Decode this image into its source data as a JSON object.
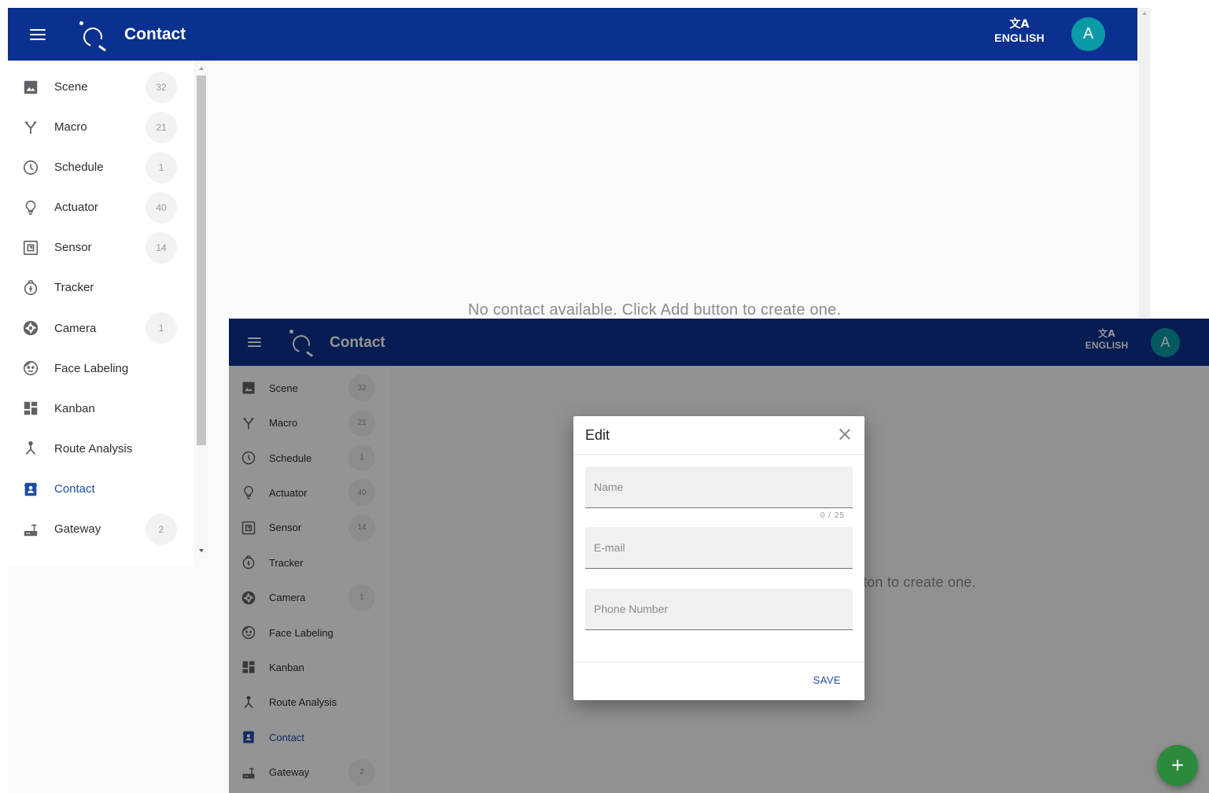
{
  "app": {
    "title": "Contact",
    "language": "ENGLISH",
    "avatar_initial": "A"
  },
  "sidebar": {
    "items": [
      {
        "label": "Scene",
        "icon": "image-icon",
        "count": "32"
      },
      {
        "label": "Macro",
        "icon": "macro-fork-icon",
        "count": "21"
      },
      {
        "label": "Schedule",
        "icon": "clock-icon",
        "count": "1"
      },
      {
        "label": "Actuator",
        "icon": "lightbulb-icon",
        "count": "40"
      },
      {
        "label": "Sensor",
        "icon": "sensor-icon",
        "count": "14"
      },
      {
        "label": "Tracker",
        "icon": "touch-icon",
        "count": ""
      },
      {
        "label": "Camera",
        "icon": "aperture-icon",
        "count": "1"
      },
      {
        "label": "Face Labeling",
        "icon": "face-icon",
        "count": ""
      },
      {
        "label": "Kanban",
        "icon": "dashboard-icon",
        "count": ""
      },
      {
        "label": "Route Analysis",
        "icon": "route-icon",
        "count": ""
      },
      {
        "label": "Contact",
        "icon": "contact-icon",
        "count": "",
        "active": true
      },
      {
        "label": "Gateway",
        "icon": "router-icon",
        "count": "2"
      }
    ]
  },
  "main": {
    "empty_message": "No contact available. Click Add button to create one.",
    "partial_message": "ton to create one."
  },
  "dialog": {
    "title": "Edit",
    "name_placeholder": "Name",
    "name_counter": "0 / 25",
    "email_placeholder": "E-mail",
    "phone_placeholder": "Phone Number",
    "save_label": "SAVE"
  },
  "fab": {
    "label": "+"
  },
  "colors": {
    "topbar": "#0b3190",
    "accent": "#1f4aa8",
    "avatar": "#0a9aa8",
    "fab": "#2c8a3c"
  }
}
